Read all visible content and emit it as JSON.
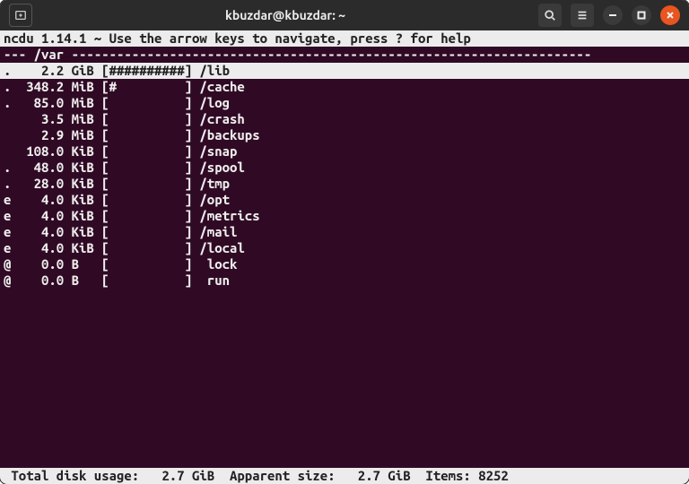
{
  "titlebar": {
    "title": "kbuzdar@kbuzdar: ~"
  },
  "ncdu": {
    "header": "ncdu 1.14.1 ~ Use the arrow keys to navigate, press ? for help",
    "path_prefix": "--- ",
    "path": "/var",
    "path_dashes": " ---------------------------------------------------------------------",
    "rows": [
      {
        "flag": ".",
        "size": "2.2",
        "unit": "GiB",
        "bar": "##########",
        "name": "/lib",
        "selected": true
      },
      {
        "flag": ".",
        "size": "348.2",
        "unit": "MiB",
        "bar": "#         ",
        "name": "/cache",
        "selected": false
      },
      {
        "flag": ".",
        "size": "85.0",
        "unit": "MiB",
        "bar": "          ",
        "name": "/log",
        "selected": false
      },
      {
        "flag": " ",
        "size": "3.5",
        "unit": "MiB",
        "bar": "          ",
        "name": "/crash",
        "selected": false
      },
      {
        "flag": " ",
        "size": "2.9",
        "unit": "MiB",
        "bar": "          ",
        "name": "/backups",
        "selected": false
      },
      {
        "flag": " ",
        "size": "108.0",
        "unit": "KiB",
        "bar": "          ",
        "name": "/snap",
        "selected": false
      },
      {
        "flag": ".",
        "size": "48.0",
        "unit": "KiB",
        "bar": "          ",
        "name": "/spool",
        "selected": false
      },
      {
        "flag": ".",
        "size": "28.0",
        "unit": "KiB",
        "bar": "          ",
        "name": "/tmp",
        "selected": false
      },
      {
        "flag": "e",
        "size": "4.0",
        "unit": "KiB",
        "bar": "          ",
        "name": "/opt",
        "selected": false
      },
      {
        "flag": "e",
        "size": "4.0",
        "unit": "KiB",
        "bar": "          ",
        "name": "/metrics",
        "selected": false
      },
      {
        "flag": "e",
        "size": "4.0",
        "unit": "KiB",
        "bar": "          ",
        "name": "/mail",
        "selected": false
      },
      {
        "flag": "e",
        "size": "4.0",
        "unit": "KiB",
        "bar": "          ",
        "name": "/local",
        "selected": false
      },
      {
        "flag": "@",
        "size": "0.0",
        "unit": "B",
        "bar": "          ",
        "name": " lock",
        "selected": false
      },
      {
        "flag": "@",
        "size": "0.0",
        "unit": "B",
        "bar": "          ",
        "name": " run",
        "selected": false
      }
    ],
    "status": {
      "total_label": " Total disk usage:",
      "total_value": "2.7 GiB",
      "apparent_label": "Apparent size:",
      "apparent_value": "2.7 GiB",
      "items_label": "Items:",
      "items_value": "8252"
    }
  }
}
